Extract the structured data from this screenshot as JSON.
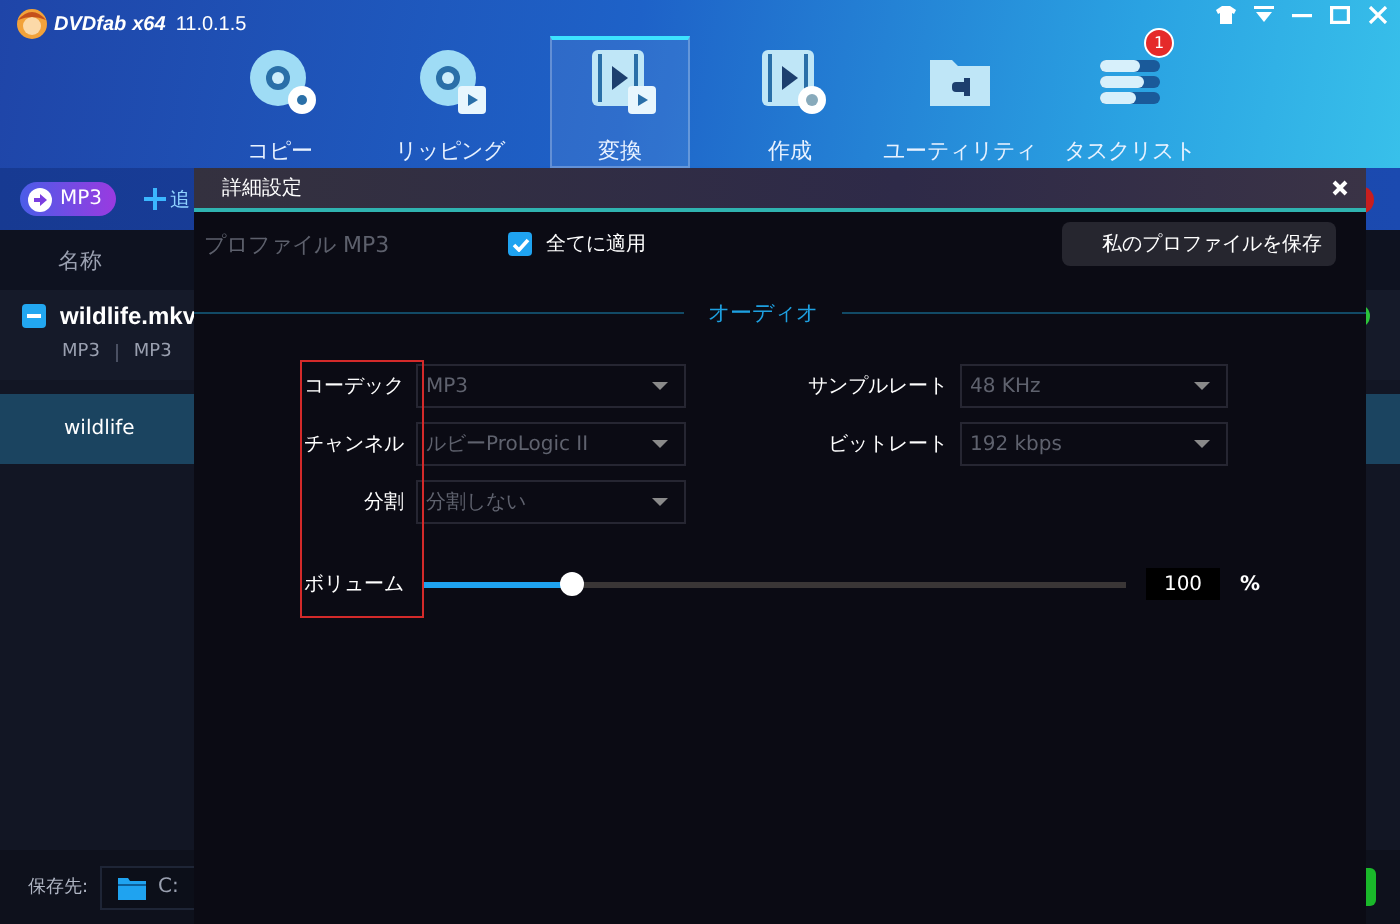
{
  "app": {
    "logo": "DVDfab",
    "arch": "x64",
    "version": "11.0.1.5"
  },
  "nav": [
    {
      "label": "コピー",
      "kind": "disc",
      "selected": false
    },
    {
      "label": "リッピング",
      "kind": "disc-film",
      "selected": false
    },
    {
      "label": "変換",
      "kind": "film",
      "selected": true
    },
    {
      "label": "作成",
      "kind": "film-disc",
      "selected": false
    },
    {
      "label": "ユーティリティ",
      "kind": "folder",
      "selected": false
    },
    {
      "label": "タスクリスト",
      "kind": "tasks",
      "selected": false,
      "badge": "1"
    }
  ],
  "toolbar": {
    "profile_button": "MP3",
    "add_label": "追"
  },
  "list": {
    "column": "名称",
    "file": {
      "title": "wildlife.mkv",
      "formats": [
        "MP3",
        "MP3"
      ]
    },
    "output": {
      "label": "wildlife",
      "selected": true
    }
  },
  "footer": {
    "label": "保存先:",
    "path": "C:"
  },
  "dialog": {
    "title": "詳細設定",
    "profile": "プロファイル MP3",
    "apply_all": {
      "label": "全てに適用",
      "checked": true
    },
    "save_button": "私のプロファイルを保存",
    "section": "オーディオ",
    "fields": [
      {
        "label": "コーデック",
        "value": "MP3"
      },
      {
        "label": "サンプルレート",
        "value": "48 KHz"
      },
      {
        "label": "チャンネル",
        "value": "ルビーProLogic II"
      },
      {
        "label": "ビットレート",
        "value": "192 kbps"
      },
      {
        "label": "分割",
        "value": "分割しない"
      }
    ],
    "volume": {
      "label": "ボリューム",
      "level": 0.21,
      "value": "100",
      "unit": "%"
    }
  }
}
